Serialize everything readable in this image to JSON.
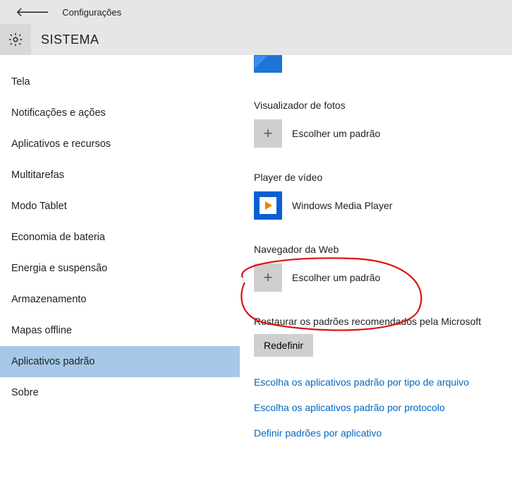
{
  "header": {
    "app_title": "Configurações",
    "section_title": "SISTEMA"
  },
  "sidebar": {
    "items": [
      {
        "label": "Tela"
      },
      {
        "label": "Notificações e ações"
      },
      {
        "label": "Aplicativos e recursos"
      },
      {
        "label": "Multitarefas"
      },
      {
        "label": "Modo Tablet"
      },
      {
        "label": "Economia de bateria"
      },
      {
        "label": "Energia e suspensão"
      },
      {
        "label": "Armazenamento"
      },
      {
        "label": "Mapas offline"
      },
      {
        "label": "Aplicativos padrão"
      },
      {
        "label": "Sobre"
      }
    ],
    "selected_index": 9
  },
  "content": {
    "categories": [
      {
        "title": "Visualizador de fotos",
        "choice_label": "Escolher um padrão",
        "tile_type": "plus"
      },
      {
        "title": "Player de vídeo",
        "choice_label": "Windows Media Player",
        "tile_type": "wmp"
      },
      {
        "title": "Navegador da Web",
        "choice_label": "Escolher um padrão",
        "tile_type": "plus"
      }
    ],
    "restore": {
      "label": "Restaurar os padrões recomendados pela Microsoft",
      "button": "Redefinir"
    },
    "links": [
      "Escolha os aplicativos padrão por tipo de arquivo",
      "Escolha os aplicativos padrão por protocolo",
      "Definir padrões por aplicativo"
    ]
  }
}
